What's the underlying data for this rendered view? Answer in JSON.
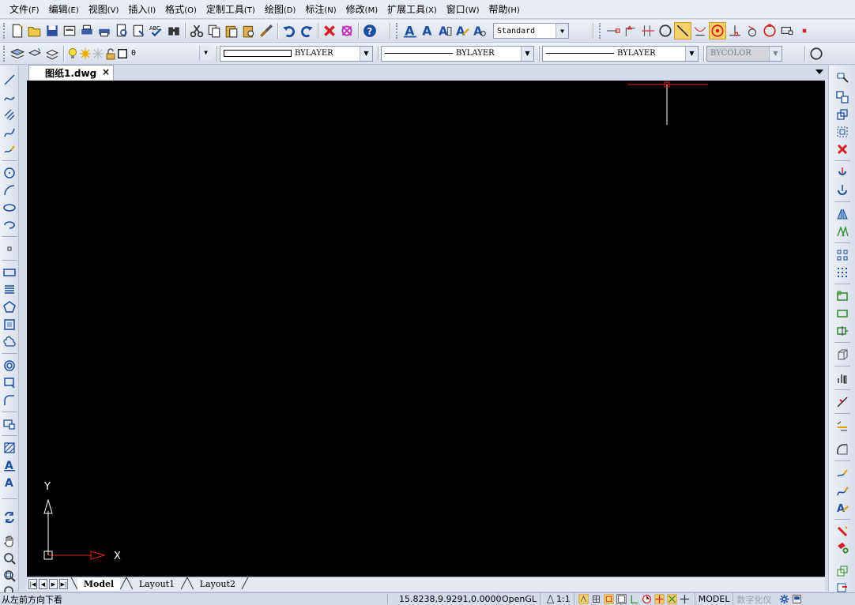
{
  "menu": [
    {
      "label": "文件",
      "accel": "(F)"
    },
    {
      "label": "编辑",
      "accel": "(E)"
    },
    {
      "label": "视图",
      "accel": "(V)"
    },
    {
      "label": "插入",
      "accel": "(I)"
    },
    {
      "label": "格式",
      "accel": "(O)"
    },
    {
      "label": "定制工具",
      "accel": "(T)"
    },
    {
      "label": "绘图",
      "accel": "(D)"
    },
    {
      "label": "标注",
      "accel": "(N)"
    },
    {
      "label": "修改",
      "accel": "(M)"
    },
    {
      "label": "扩展工具",
      "accel": "(X)"
    },
    {
      "label": "窗口",
      "accel": "(W)"
    },
    {
      "label": "帮助",
      "accel": "(H)"
    }
  ],
  "toolbar": {
    "text_style": "Standard",
    "layer": "0",
    "color": "BYLAYER",
    "linetype": "BYLAYER",
    "lineweight": "BYLAYER",
    "plotstyle": "BYCOLOR"
  },
  "document_tab": {
    "title": "图纸1.dwg",
    "close": "×"
  },
  "ucs": {
    "x_label": "X",
    "y_label": "Y"
  },
  "layout_tabs": [
    "Model",
    "Layout1",
    "Layout2"
  ],
  "status": {
    "command": "从左前方向下看",
    "coords": "15.8238,9.9291,0.0000",
    "renderer": "OpenGL",
    "scale": "1:1",
    "space": "MODEL",
    "extra": "数字化仪"
  },
  "colors": {
    "canvas": "#000000",
    "crosshair_h": "#e02020",
    "crosshair_v": "#ffffff",
    "ucs_x": "#e02020",
    "ucs_y": "#ffffff",
    "icon_blue": "#1a4fa0",
    "icon_red": "#d42020"
  }
}
